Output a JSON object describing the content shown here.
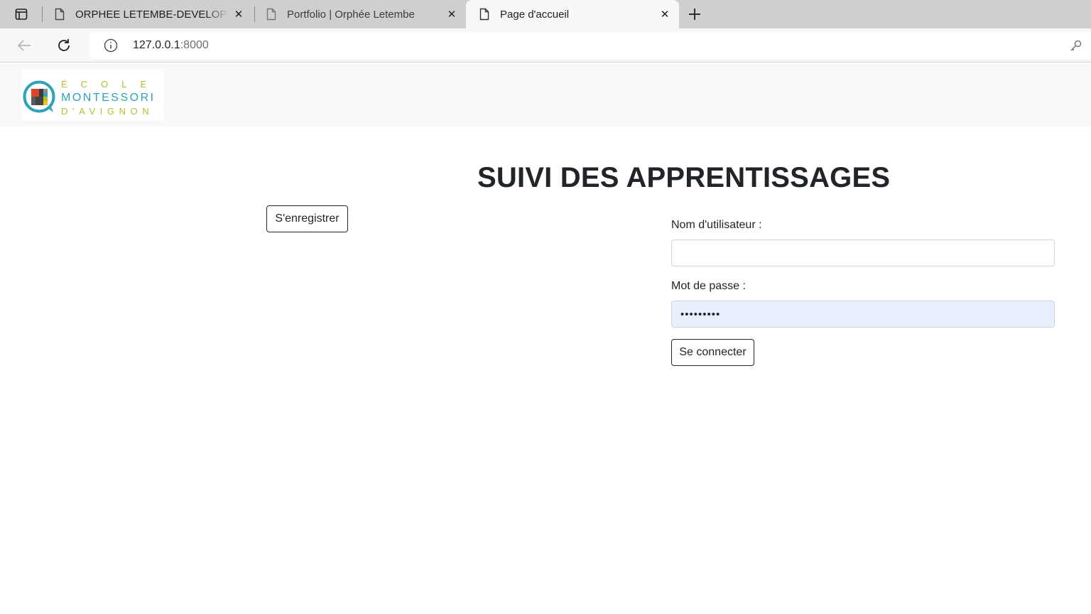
{
  "browser": {
    "tabs": [
      {
        "title": "ORPHEE LETEMBE-DEVELOPPEUR",
        "close": "✕",
        "active": false
      },
      {
        "title": "Portfolio | Orphée Letembe",
        "close": "✕",
        "active": false
      },
      {
        "title": "Page d'accueil",
        "close": "✕",
        "active": true
      }
    ],
    "address": {
      "host": "127.0.0.1",
      "port": ":8000"
    },
    "icons": [
      "tab-actions-icon",
      "page-icon",
      "close-icon",
      "plus-icon",
      "back-arrow-icon",
      "reload-icon",
      "info-icon",
      "key-icon"
    ]
  },
  "header": {
    "logo": {
      "line1": "ÉCOLE",
      "line2": "MONTESSORI",
      "line3": "D'AVIGNON"
    }
  },
  "main": {
    "title": "SUIVI DES APPRENTISSAGES",
    "register_label": "S'enregistrer",
    "form": {
      "username_label": "Nom d'utilisateur :",
      "username_value": "",
      "password_label": "Mot de passe :",
      "password_value": "•••••••••",
      "submit_label": "Se connecter"
    }
  },
  "colors": {
    "logo_teal": "#2ea3b8",
    "logo_green": "#b5c02a",
    "autofill_bg": "#e8f0fe"
  }
}
